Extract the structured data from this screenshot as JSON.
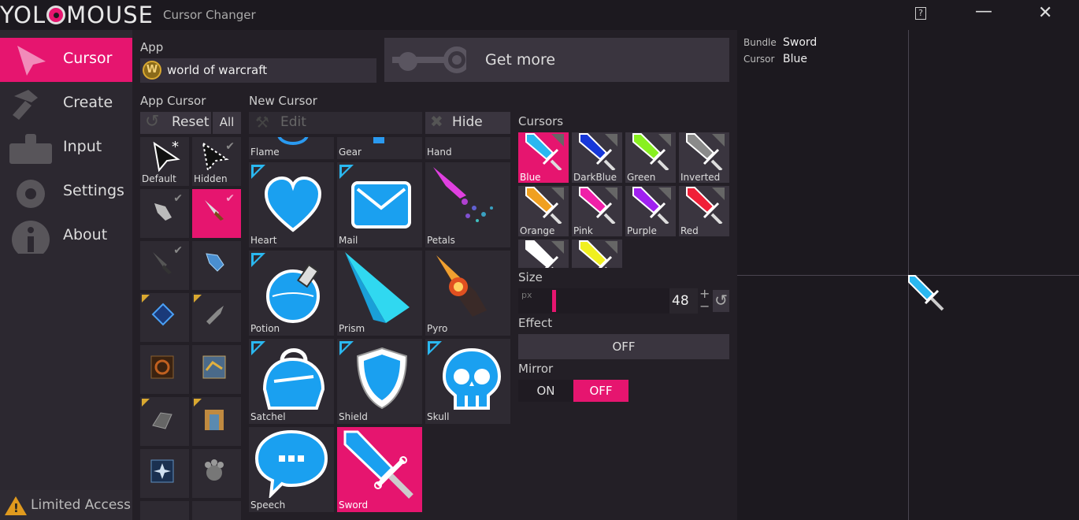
{
  "app": {
    "brand_left": "YOL",
    "brand_right": "MOUSE",
    "subtitle": "Cursor Changer",
    "help": "?",
    "minimize": "—",
    "close": "✕"
  },
  "nav": {
    "items": [
      {
        "label": "Cursor",
        "icon": "cursor-icon"
      },
      {
        "label": "Create",
        "icon": "hammer-icon"
      },
      {
        "label": "Input",
        "icon": "keyboard-icon"
      },
      {
        "label": "Settings",
        "icon": "gear-icon"
      },
      {
        "label": "About",
        "icon": "info-icon"
      }
    ],
    "limited": "Limited Access"
  },
  "appsel": {
    "label": "App",
    "value": "world of warcraft",
    "getmore": "Get more"
  },
  "appcursor": {
    "label": "App Cursor",
    "reset": "Reset",
    "all": "All",
    "items": [
      {
        "label": "Default"
      },
      {
        "label": "Hidden"
      }
    ]
  },
  "newcursor": {
    "label": "New Cursor",
    "edit": "Edit",
    "hide": "Hide",
    "items": [
      "Flame",
      "Gear",
      "Hand",
      "Heart",
      "Mail",
      "Petals",
      "Potion",
      "Prism",
      "Pyro",
      "Satchel",
      "Shield",
      "Skull",
      "Speech",
      "Sword"
    ]
  },
  "cursors": {
    "label": "Cursors",
    "items": [
      "Blue",
      "DarkBlue",
      "Green",
      "Inverted",
      "Orange",
      "Pink",
      "Purple",
      "Red"
    ],
    "colors": [
      "#2ab8f0",
      "#1637d8",
      "#88f020",
      "#8a8a8a",
      "#f0a020",
      "#f020a8",
      "#a020f0",
      "#f02038",
      "#ffffff",
      "#f0f020"
    ]
  },
  "size": {
    "label": "Size",
    "unit": "px",
    "value": "48",
    "plus": "+",
    "minus": "−"
  },
  "effect": {
    "label": "Effect",
    "value": "OFF"
  },
  "mirror": {
    "label": "Mirror",
    "on": "ON",
    "off": "OFF"
  },
  "preview": {
    "bundle_label": "Bundle",
    "bundle_value": "Sword",
    "cursor_label": "Cursor",
    "cursor_value": "Blue"
  }
}
